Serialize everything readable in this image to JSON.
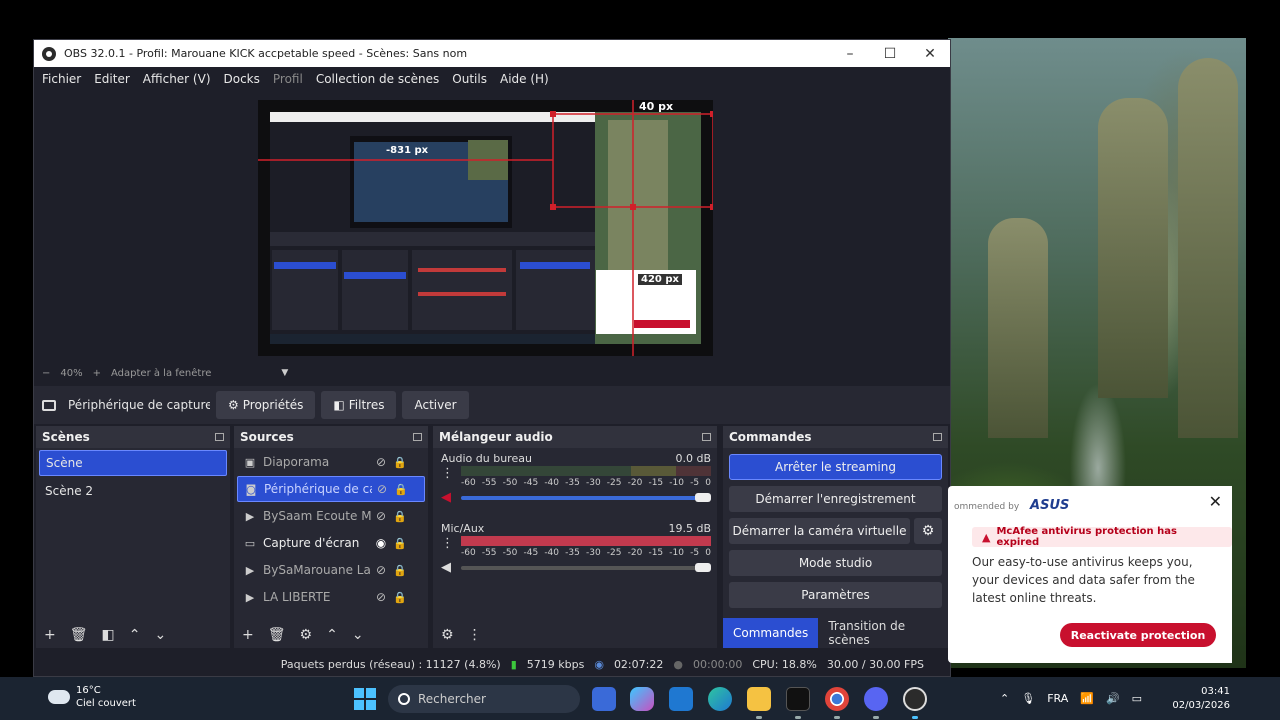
{
  "window": {
    "title": "OBS 32.0.1 - Profil: Marouane KICK accpetable speed - Scènes: Sans nom",
    "minimize": "–",
    "maximize": "☐",
    "close": "✕"
  },
  "menu": [
    "Fichier",
    "Editer",
    "Afficher (V)",
    "Docks",
    "Profil",
    "Collection de scènes",
    "Outils",
    "Aide (H)"
  ],
  "preview": {
    "overlay_top": "40 px",
    "overlay_left": "-831 px",
    "overlay_mid": "420 px"
  },
  "zoom": {
    "minus": "−",
    "level": "40%",
    "plus": "+",
    "fit": "Adapter à la fenêtre",
    "arrow": "▼"
  },
  "source_toolbar": {
    "name": "Périphérique de capture vid",
    "properties": "Propriétés",
    "filters": "Filtres",
    "activate": "Activer"
  },
  "scenes": {
    "title": "Scènes",
    "items": [
      "Scène",
      "Scène 2"
    ],
    "selected": 0
  },
  "sources": {
    "title": "Sources",
    "items": [
      {
        "label": "Diaporama",
        "icon": "slideshow-icon",
        "visible": false
      },
      {
        "label": "Périphérique de capture vidéo",
        "icon": "camera-icon",
        "visible": false
      },
      {
        "label": "BySaam Ecoute Moi",
        "icon": "play-icon",
        "visible": false
      },
      {
        "label": "Capture d'écran",
        "icon": "monitor-icon",
        "visible": true
      },
      {
        "label": "BySaMarouane La Liberte",
        "icon": "play-icon",
        "visible": false
      },
      {
        "label": "LA LIBERTE",
        "icon": "play-icon",
        "visible": false
      }
    ],
    "selected": 1
  },
  "mixer": {
    "title": "Mélangeur audio",
    "channels": [
      {
        "name": "Audio du bureau",
        "level": "0.0 dB"
      },
      {
        "name": "Mic/Aux",
        "level": "19.5 dB"
      }
    ],
    "scale": [
      "-60",
      "-55",
      "-50",
      "-45",
      "-40",
      "-35",
      "-30",
      "-25",
      "-20",
      "-15",
      "-10",
      "-5",
      "0"
    ]
  },
  "controls": {
    "title": "Commandes",
    "stop_streaming": "Arrêter le streaming",
    "start_recording": "Démarrer l'enregistrement",
    "start_virtual_cam": "Démarrer la caméra virtuelle",
    "studio_mode": "Mode studio",
    "settings": "Paramètres",
    "tab_controls": "Commandes",
    "tab_transitions": "Transition de scènes"
  },
  "status": {
    "dropped": "Paquets perdus (réseau) : 11127 (4.8%)",
    "bitrate": "5719 kbps",
    "stream_time": "02:07:22",
    "rec_time": "00:00:00",
    "cpu": "CPU: 18.8%",
    "fps": "30.00 / 30.00 FPS"
  },
  "toast": {
    "brand": "ommended by",
    "brand_logo": "ASUS",
    "alert": "McAfee antivirus protection has expired",
    "message": "Our easy-to-use antivirus keeps you, your devices and data safer from the latest online threats.",
    "cta": "Reactivate protection"
  },
  "taskbar": {
    "temp": "16°C",
    "weather": "Ciel couvert",
    "search": "Rechercher",
    "lang": "FRA",
    "time": "03:41",
    "date": "02/03/2026"
  },
  "colors": {
    "accent": "#2b4ed1",
    "dock_bg": "#272833",
    "alert_red": "#c8102e"
  }
}
